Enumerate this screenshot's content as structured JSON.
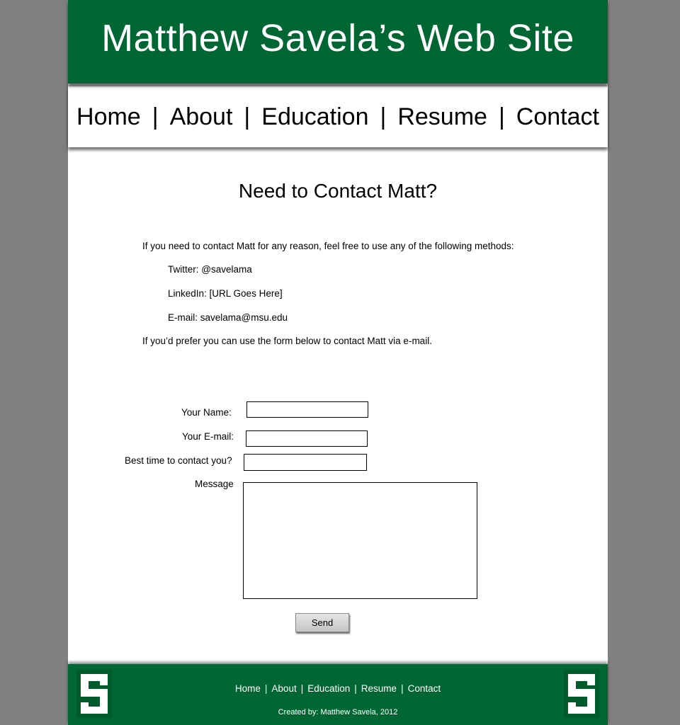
{
  "header": {
    "title": "Matthew Savela’s Web Site"
  },
  "nav": {
    "home": "Home",
    "about": "About",
    "education": "Education",
    "resume": "Resume",
    "contact": "Contact",
    "separator": "|"
  },
  "main": {
    "title": "Need to Contact Matt?",
    "intro": "If you need to contact Matt for any reason, feel free to use any of the following methods:",
    "methods": [
      "Twitter: @savelama",
      "LinkedIn: [URL Goes Here]",
      "E-mail: savelama@msu.edu"
    ],
    "outro": "If you’d prefer you can use the form below to contact Matt via e-mail."
  },
  "form": {
    "name_label": "Your Name:",
    "email_label": "Your E-mail:",
    "time_label": "Best time to contact you?",
    "message_label": "Message",
    "name_value": "",
    "email_value": "",
    "time_value": "",
    "message_value": "",
    "send_label": "Send"
  },
  "footer": {
    "home": "Home",
    "about": "About",
    "education": "Education",
    "resume": "Resume",
    "contact": "Contact",
    "separator": "|",
    "credit": "Created by: Matthew Savela, 2012",
    "logo_icon": "spartan-s-icon"
  },
  "colors": {
    "brand_green": "#006633",
    "background": "#808080"
  }
}
